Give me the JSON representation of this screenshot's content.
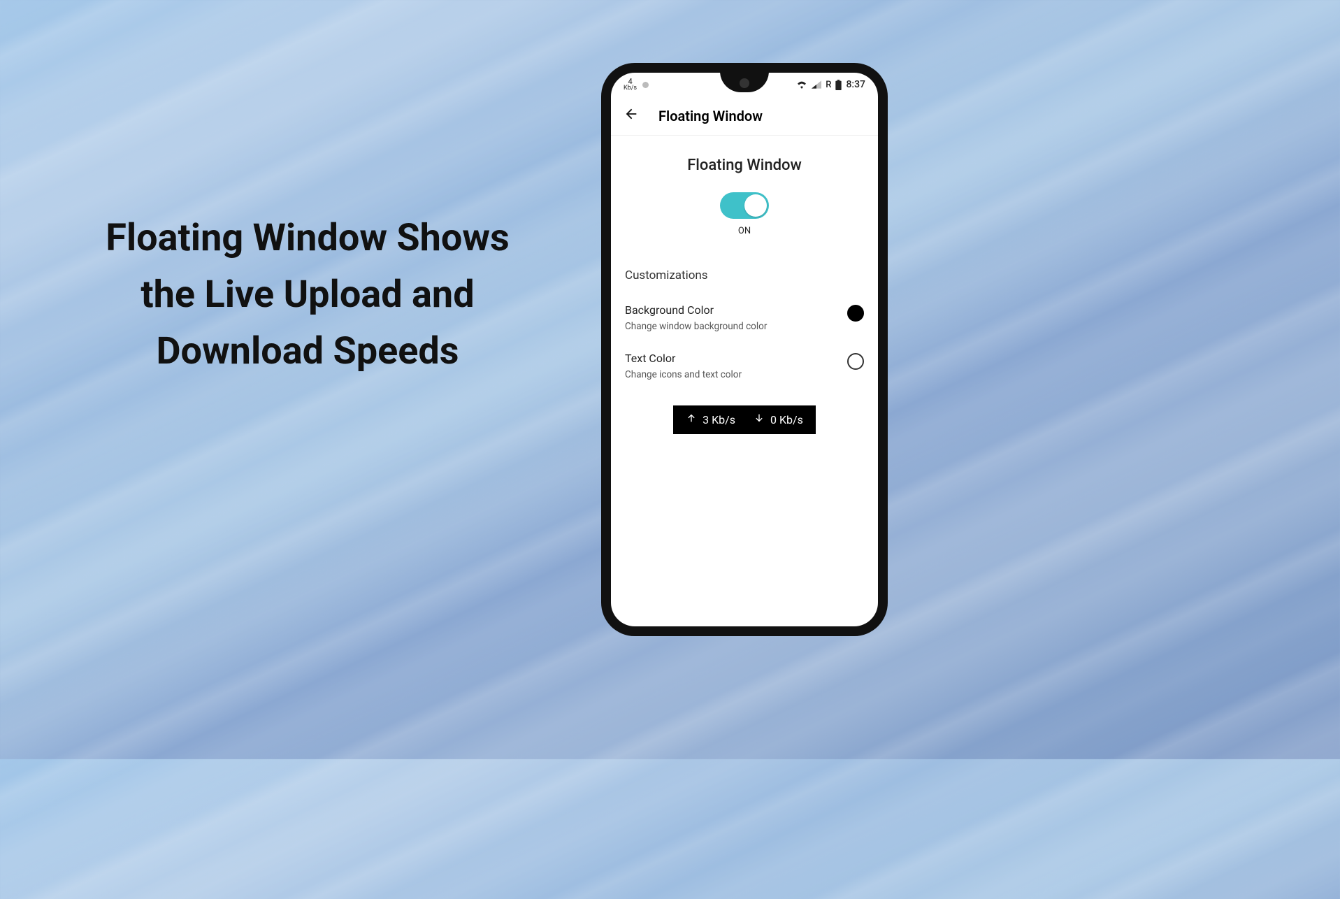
{
  "headline": "Floating Window Shows the Live Upload and Download Speeds",
  "statusbar": {
    "speed_indicator_value": "4",
    "speed_indicator_unit": "Kb/s",
    "roaming_label": "R",
    "time": "8:37"
  },
  "appbar": {
    "title": "Floating Window"
  },
  "main": {
    "section_title": "Floating Window",
    "toggle_state": "ON",
    "customizations_heading": "Customizations",
    "rows": [
      {
        "label": "Background Color",
        "description": "Change window background color",
        "swatch_color": "#000000"
      },
      {
        "label": "Text Color",
        "description": "Change icons and text color",
        "swatch_color": "#ffffff"
      }
    ],
    "speed_widget": {
      "upload": "3 Kb/s",
      "download": "0 Kb/s"
    }
  },
  "colors": {
    "toggle_on": "#3fc1c9"
  }
}
